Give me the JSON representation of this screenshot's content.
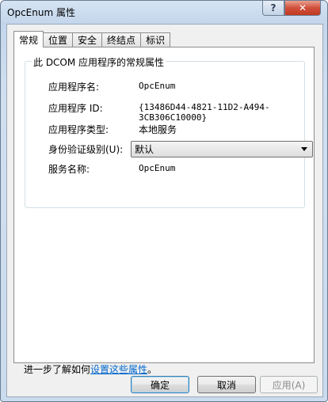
{
  "window": {
    "title": "OpcEnum 属性"
  },
  "titlebar": {
    "help_label": "?",
    "close_label": "✕"
  },
  "tabs": [
    {
      "label": "常规"
    },
    {
      "label": "位置"
    },
    {
      "label": "安全"
    },
    {
      "label": "终结点"
    },
    {
      "label": "标识"
    }
  ],
  "group": {
    "title": "此 DCOM 应用程序的常规属性",
    "fields": [
      {
        "label": "应用程序名:",
        "value": "OpcEnum"
      },
      {
        "label": "应用程序 ID:",
        "value": "{13486D44-4821-11D2-A494-3CB306C10000}"
      },
      {
        "label": "应用程序类型:",
        "value": "本地服务"
      },
      {
        "label": "身份验证级别(U):",
        "value": "默认"
      },
      {
        "label": "服务名称:",
        "value": "OpcEnum"
      }
    ]
  },
  "footer": {
    "prefix": "进一步了解如何",
    "link": "设置这些属性",
    "suffix": "。"
  },
  "buttons": {
    "ok": "确定",
    "cancel": "取消",
    "apply": "应用(A)"
  }
}
